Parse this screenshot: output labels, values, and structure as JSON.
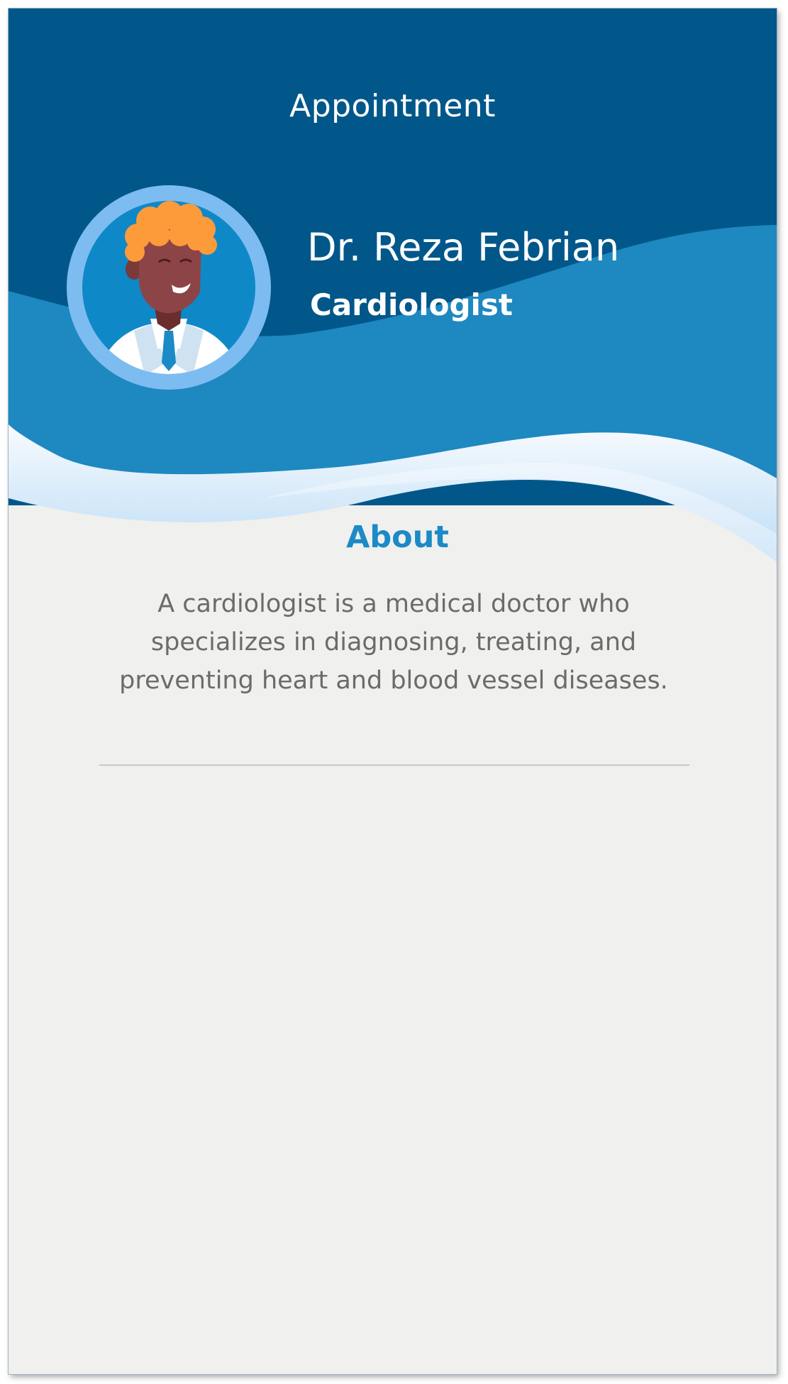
{
  "header": {
    "title": "Appointment"
  },
  "doctor": {
    "name": "Dr. Reza Febrian",
    "specialty": "Cardiologist",
    "avatar_icon": "doctor-avatar-icon"
  },
  "about": {
    "title": "About",
    "description": "A cardiologist is a medical doctor who specializes in diagnosing, treating, and preventing heart and blood vessel diseases."
  },
  "colors": {
    "header_dark": "#01578a",
    "header_mid": "#1e88c0",
    "accent": "#1b8ac7",
    "background": "#f0f0ee",
    "text_muted": "#6b6b6b"
  }
}
